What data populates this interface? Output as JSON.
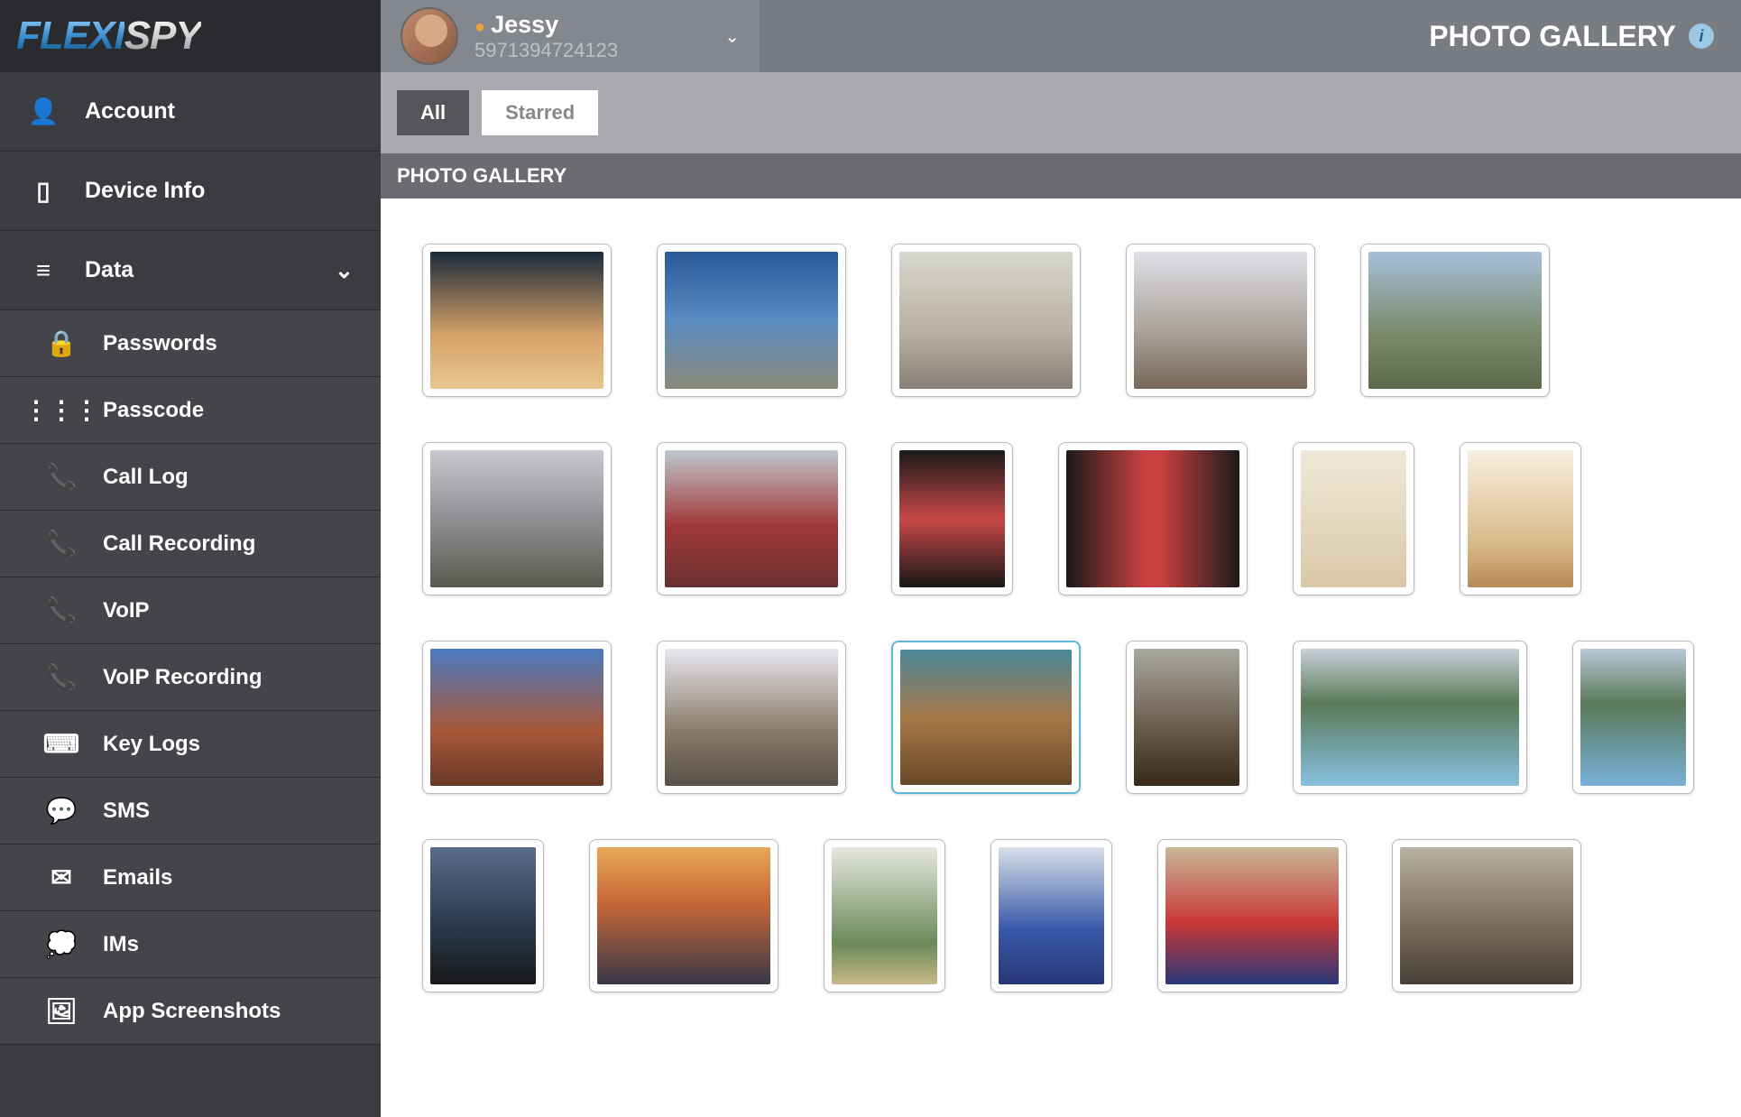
{
  "logo": {
    "part1": "FLEXI",
    "part2": "SPY"
  },
  "header": {
    "user_name": "Jessy",
    "user_id": "5971394724123",
    "page_title": "PHOTO GALLERY"
  },
  "sidebar": {
    "main": [
      {
        "icon": "user-icon",
        "glyph": "👤",
        "label": "Account"
      },
      {
        "icon": "device-icon",
        "glyph": "▯",
        "label": "Device Info"
      },
      {
        "icon": "data-icon",
        "glyph": "≡",
        "label": "Data",
        "expanded": true
      }
    ],
    "sub": [
      {
        "icon": "lock-icon",
        "glyph": "🔒",
        "label": "Passwords"
      },
      {
        "icon": "grid-icon",
        "glyph": "⋮⋮⋮",
        "label": "Passcode"
      },
      {
        "icon": "phone-icon",
        "glyph": "📞",
        "label": "Call Log"
      },
      {
        "icon": "record-icon",
        "glyph": "📞",
        "label": "Call Recording"
      },
      {
        "icon": "voip-icon",
        "glyph": "📞",
        "label": "VoIP"
      },
      {
        "icon": "voip-rec-icon",
        "glyph": "📞",
        "label": "VoIP Recording"
      },
      {
        "icon": "keyboard-icon",
        "glyph": "⌨",
        "label": "Key Logs"
      },
      {
        "icon": "sms-icon",
        "glyph": "💬",
        "label": "SMS"
      },
      {
        "icon": "email-icon",
        "glyph": "✉",
        "label": "Emails"
      },
      {
        "icon": "im-icon",
        "glyph": "💭",
        "label": "IMs"
      },
      {
        "icon": "screenshot-icon",
        "glyph": "🖼",
        "label": "App Screenshots"
      }
    ]
  },
  "tabs": {
    "all": "All",
    "starred": "Starred",
    "active": "all"
  },
  "section_header": "PHOTO GALLERY",
  "gallery": {
    "thumbs": [
      {
        "shape": "",
        "fill": "p0"
      },
      {
        "shape": "",
        "fill": "p1"
      },
      {
        "shape": "",
        "fill": "p2"
      },
      {
        "shape": "",
        "fill": "p3"
      },
      {
        "shape": "",
        "fill": "p4"
      },
      {
        "shape": "",
        "fill": "p5"
      },
      {
        "shape": "",
        "fill": "p6"
      },
      {
        "shape": "narrow",
        "fill": "p7"
      },
      {
        "shape": "",
        "fill": "p8"
      },
      {
        "shape": "narrow",
        "fill": "p9"
      },
      {
        "shape": "narrow",
        "fill": "p10"
      },
      {
        "shape": "",
        "fill": "p11"
      },
      {
        "shape": "",
        "fill": "p12"
      },
      {
        "shape": "",
        "fill": "p13",
        "selected": true
      },
      {
        "shape": "narrow",
        "fill": "p14"
      },
      {
        "shape": "wide",
        "fill": "p15"
      },
      {
        "shape": "narrow",
        "fill": "p16"
      },
      {
        "shape": "narrow",
        "fill": "p17"
      },
      {
        "shape": "",
        "fill": "p18"
      },
      {
        "shape": "narrow",
        "fill": "p19"
      },
      {
        "shape": "narrow",
        "fill": "p20"
      },
      {
        "shape": "",
        "fill": "p21"
      },
      {
        "shape": "",
        "fill": "p22"
      }
    ]
  }
}
